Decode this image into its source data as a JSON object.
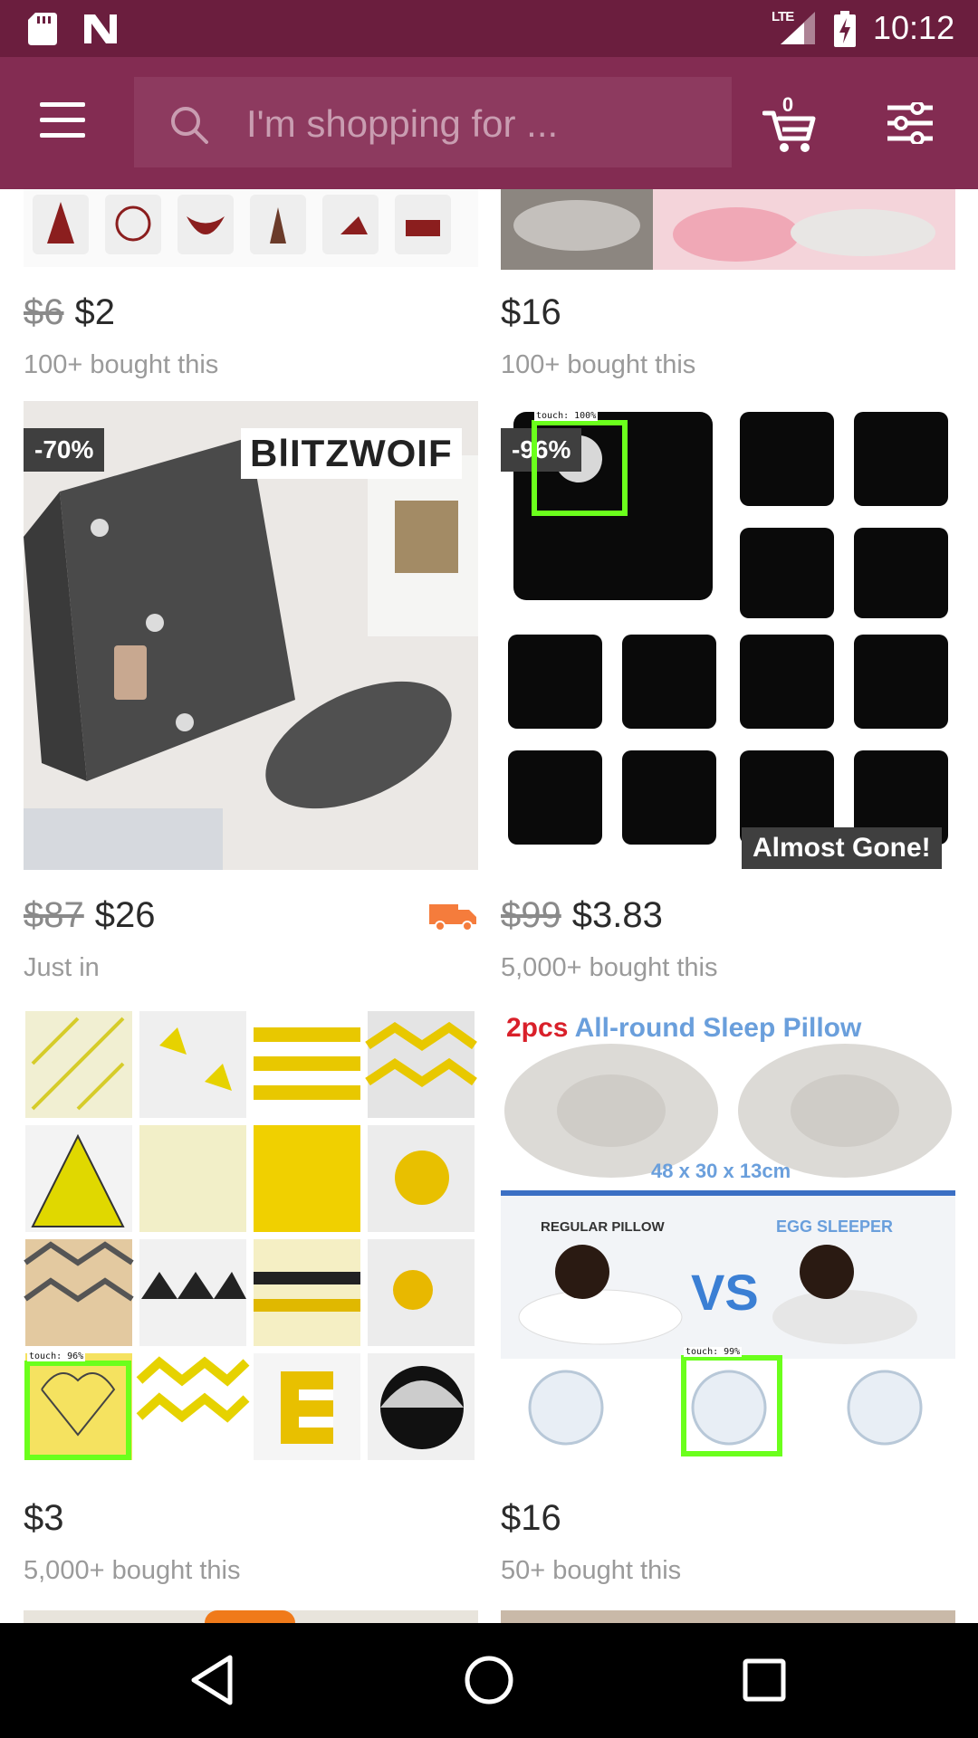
{
  "status_bar": {
    "network": "LTE",
    "time": "10:12"
  },
  "app_bar": {
    "search_placeholder": "I'm shopping for ...",
    "cart_count": "0"
  },
  "products": [
    {
      "old_price": "$6",
      "price": "$2",
      "subtitle": "100+ bought this"
    },
    {
      "old_price": "",
      "price": "$16",
      "subtitle": "100+ bought this"
    },
    {
      "badge": "-70%",
      "brand": "BlITZWOIF",
      "old_price": "$87",
      "price": "$26",
      "subtitle": "Just in",
      "shipping_icon": "truck-icon"
    },
    {
      "badge": "-96%",
      "tag": "Almost Gone!",
      "old_price": "$99",
      "price": "$3.83",
      "subtitle": "5,000+ bought this"
    },
    {
      "old_price": "",
      "price": "$3",
      "subtitle": "5,000+ bought this"
    },
    {
      "image_texts": {
        "count": "2pcs",
        "headline": "All-round Sleep Pillow",
        "size": "48 x 30 x 13cm",
        "left": "REGULAR PILLOW",
        "right": "EGG SLEEPER",
        "vs": "VS"
      },
      "old_price": "",
      "price": "$16",
      "subtitle": "50+ bought this"
    }
  ],
  "touch_overlays": [
    {
      "label": "touch: 100%"
    },
    {
      "label": "touch: 96%"
    },
    {
      "label": "touch: 99%"
    }
  ],
  "colors": {
    "status_bar": "#6b1e3e",
    "app_bar": "#832c52",
    "touch_box": "#6bff1c"
  }
}
